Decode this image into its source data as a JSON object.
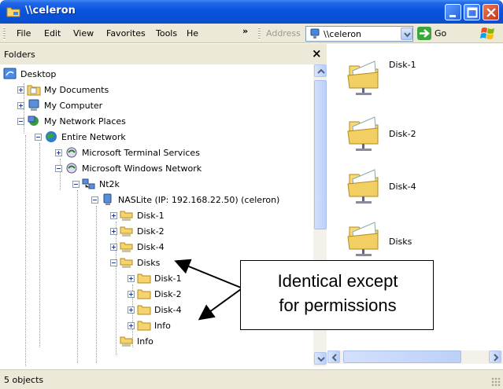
{
  "window": {
    "title": "\\\\celeron"
  },
  "menu": {
    "items": [
      "File",
      "Edit",
      "View",
      "Favorites",
      "Tools",
      "He"
    ],
    "underline_index": [
      0,
      0,
      0,
      1,
      0,
      1
    ],
    "overflow": "»",
    "address_label": "Address",
    "address_value": "\\\\celeron",
    "go_label": "Go"
  },
  "folders": {
    "header": "Folders",
    "close": "×",
    "tree": [
      {
        "label": "Desktop",
        "icon": "desktop-icon"
      },
      {
        "label": "My Documents",
        "icon": "my-documents-icon"
      },
      {
        "label": "My Computer",
        "icon": "my-computer-icon"
      },
      {
        "label": "My Network Places",
        "icon": "network-places-icon"
      },
      {
        "label": "Entire Network",
        "icon": "globe-icon"
      },
      {
        "label": "Microsoft Terminal Services",
        "icon": "network-provider-icon"
      },
      {
        "label": "Microsoft Windows Network",
        "icon": "network-provider-icon"
      },
      {
        "label": "Nt2k",
        "icon": "workgroup-icon"
      },
      {
        "label": "NASLite (IP: 192.168.22.50) (celeron)",
        "icon": "server-icon"
      },
      {
        "label": "Disk-1",
        "icon": "shared-folder-icon"
      },
      {
        "label": "Disk-2",
        "icon": "shared-folder-icon"
      },
      {
        "label": "Disk-4",
        "icon": "shared-folder-icon"
      },
      {
        "label": "Disks",
        "icon": "shared-folder-icon"
      },
      {
        "label": "Disk-1",
        "icon": "folder-icon"
      },
      {
        "label": "Disk-2",
        "icon": "folder-icon"
      },
      {
        "label": "Disk-4",
        "icon": "folder-icon"
      },
      {
        "label": "Info",
        "icon": "folder-icon"
      },
      {
        "label": "Info",
        "icon": "shared-folder-icon"
      }
    ]
  },
  "right_pane": {
    "items": [
      "Disk-1",
      "Disk-2",
      "Disk-4",
      "Disks"
    ]
  },
  "status": {
    "text": "5 objects"
  },
  "callout": {
    "line1": "Identical except",
    "line2": "for permissions"
  },
  "colors": {
    "titlebar": "#0b55de",
    "chrome": "#ece9d8",
    "selection_accent": "#316ac5"
  }
}
